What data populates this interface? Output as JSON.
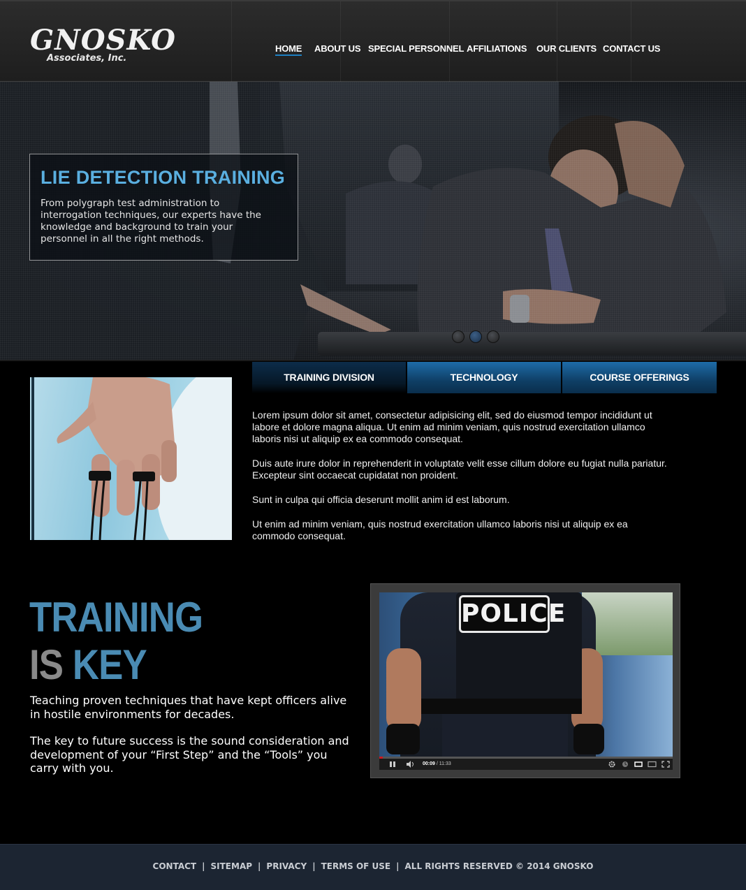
{
  "brand": {
    "name": "GNOSKO",
    "sub": "Associates, Inc."
  },
  "nav": {
    "items": [
      {
        "label": "HOME",
        "active": true
      },
      {
        "label": "ABOUT US"
      },
      {
        "label": "SPECIAL PERSONNEL"
      },
      {
        "label": "AFFILIATIONS"
      },
      {
        "label": "OUR CLIENTS"
      },
      {
        "label": "CONTACT US"
      }
    ]
  },
  "hero": {
    "title": "LIE DETECTION TRAINING",
    "text": "From polygraph test administration to interrogation techniques, our experts have the knowledge and background to train your personnel in all the right methods.",
    "slide_count": 3,
    "active_slide": 2
  },
  "tabs": {
    "items": [
      {
        "label": "TRAINING DIVISION",
        "active": true
      },
      {
        "label": "TECHNOLOGY"
      },
      {
        "label": "COURSE OFFERINGS"
      }
    ],
    "content": [
      "Lorem ipsum dolor sit amet, consectetur adipisicing elit, sed do eiusmod tempor incididunt ut labore et dolore magna aliqua. Ut enim ad minim veniam, quis nostrud exercitation ullamco laboris nisi ut aliquip ex ea commodo consequat.",
      "Duis aute irure dolor in reprehenderit in voluptate velit esse cillum dolore eu fugiat nulla pariatur. Excepteur sint occaecat cupidatat non proident.",
      "Sunt in culpa qui officia deserunt mollit anim id est laborum.",
      "Ut enim ad minim veniam, quis nostrud exercitation ullamco laboris nisi ut aliquip ex ea commodo consequat."
    ]
  },
  "training": {
    "title_line1": "TRAINING",
    "title_line2_a": "IS",
    "title_line2_b": "KEY",
    "paragraphs": [
      "Teaching proven techniques that have kept officers alive in hostile environments for decades.",
      "The key to future success is the sound consideration and development of your “First Step” and the “Tools” you carry with you."
    ]
  },
  "video": {
    "patch_text": "POLICE",
    "current_time": "00:09",
    "duration": "/ 11:33",
    "progress": 0.013
  },
  "footer": {
    "links": [
      "CONTACT",
      "SITEMAP",
      "PRIVACY",
      "TERMS OF USE"
    ],
    "copyright": "ALL RIGHTS RESERVED © 2014 GNOSKO",
    "separator": "|"
  },
  "colors": {
    "accent_blue": "#4a8bb3",
    "hero_title": "#5aafe0",
    "nav_underline": "#1e7fc1",
    "footer_bg": "#1c2532"
  }
}
